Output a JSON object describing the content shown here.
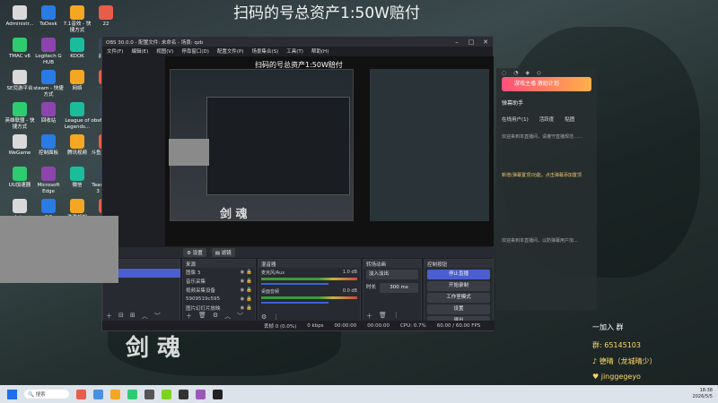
{
  "desktop": {
    "banner": "扫码的号总资产1:50W赔付",
    "icons": [
      {
        "label": "Administr...",
        "x": "left"
      },
      {
        "label": "ToDesk"
      },
      {
        "label": "7.1音效 - 快捷方式"
      },
      {
        "label": "22"
      },
      {
        "label": "TMAC v6"
      },
      {
        "label": "Logitech G HUB"
      },
      {
        "label": "KOOK"
      },
      {
        "label": "此电脑"
      },
      {
        "label": "SE児游平台"
      },
      {
        "label": "steam - 快捷方式"
      },
      {
        "label": "网络"
      },
      {
        "label": "优酷"
      },
      {
        "label": "英雄联盟 - 快捷方式"
      },
      {
        "label": "回收站"
      },
      {
        "label": "League of Legends..."
      },
      {
        "label": "obs64 - 快捷方式"
      },
      {
        "label": "WeGame"
      },
      {
        "label": "控制面板"
      },
      {
        "label": "腾讯视频"
      },
      {
        "label": "斗鱼直播伴侣"
      },
      {
        "label": "UU加速器"
      },
      {
        "label": "Microsoft Edge"
      },
      {
        "label": "微信"
      },
      {
        "label": "TeamSpeak 3 Client"
      },
      {
        "label": "qzb.json"
      },
      {
        "label": "QQ"
      },
      {
        "label": "游戏加加"
      },
      {
        "label": "rjkj"
      },
      {
        "label": "哔哩哔哩"
      },
      {
        "label": "YY开播"
      },
      {
        "label": "雷电刀装"
      }
    ]
  },
  "obs": {
    "title": "OBS 30.0.0 - 配置文件: 未命名 - 场景: qzb",
    "menu": [
      "文件(F)",
      "编辑(E)",
      "视图(V)",
      "停靠窗口(D)",
      "配置文件(P)",
      "场景集合(S)",
      "工具(T)",
      "帮助(H)"
    ],
    "preview_title": "扫码的号总资产1:50W赔付",
    "dock_buttons": [
      "设置",
      "滤镜"
    ],
    "scenes": {
      "header": "场景"
    },
    "sources": {
      "header": "来源",
      "items": [
        "图像 3",
        "音乐采集",
        "视频采集设备",
        "5909519c595",
        "图片幻灯片放映"
      ]
    },
    "mixer": {
      "header": "混音器",
      "channels": [
        {
          "name": "麦克风/Aux",
          "level": "1.0 dB"
        },
        {
          "name": "桌面音频",
          "level": "0.0 dB"
        }
      ]
    },
    "transitions": {
      "header": "转场动画",
      "type": "淡入淡出",
      "duration_label": "时长",
      "duration_value": "300 ms"
    },
    "controls": {
      "header": "控制按钮",
      "buttons": [
        "停止直播",
        "开始录制",
        "工作室模式",
        "设置",
        "退出"
      ]
    },
    "status": {
      "dropped": "丢帧 0 (0.0%)",
      "kbps": "0 kbps",
      "live_time": "00:00:00",
      "rec_time": "00:00:00",
      "cpu": "CPU: 0.7%",
      "fps": "60.00 / 60.00 FPS"
    }
  },
  "chat": {
    "banner": "游戏主播 激励计划",
    "title": "弹幕助手",
    "tabs": [
      "在线用户(1)",
      "活跃度",
      "贴图"
    ],
    "note1": "欢迎来到本直播间，请遵守直播规范……",
    "note2": "新增(弹幕置顶)功能，点击弹幕添加置顶",
    "note3": "欢迎来到本直播间，以防弹幕用户加..."
  },
  "info": {
    "join": "一加入 群",
    "group_prefix": "群:",
    "group_number": "65145103",
    "douyin": "德晴（龙城晴少）",
    "tiktok": "jinggegeyo"
  },
  "sword_text": "剑 魂",
  "taskbar": {
    "search": "搜索",
    "time": "18:38",
    "date": "2026/5/5"
  }
}
